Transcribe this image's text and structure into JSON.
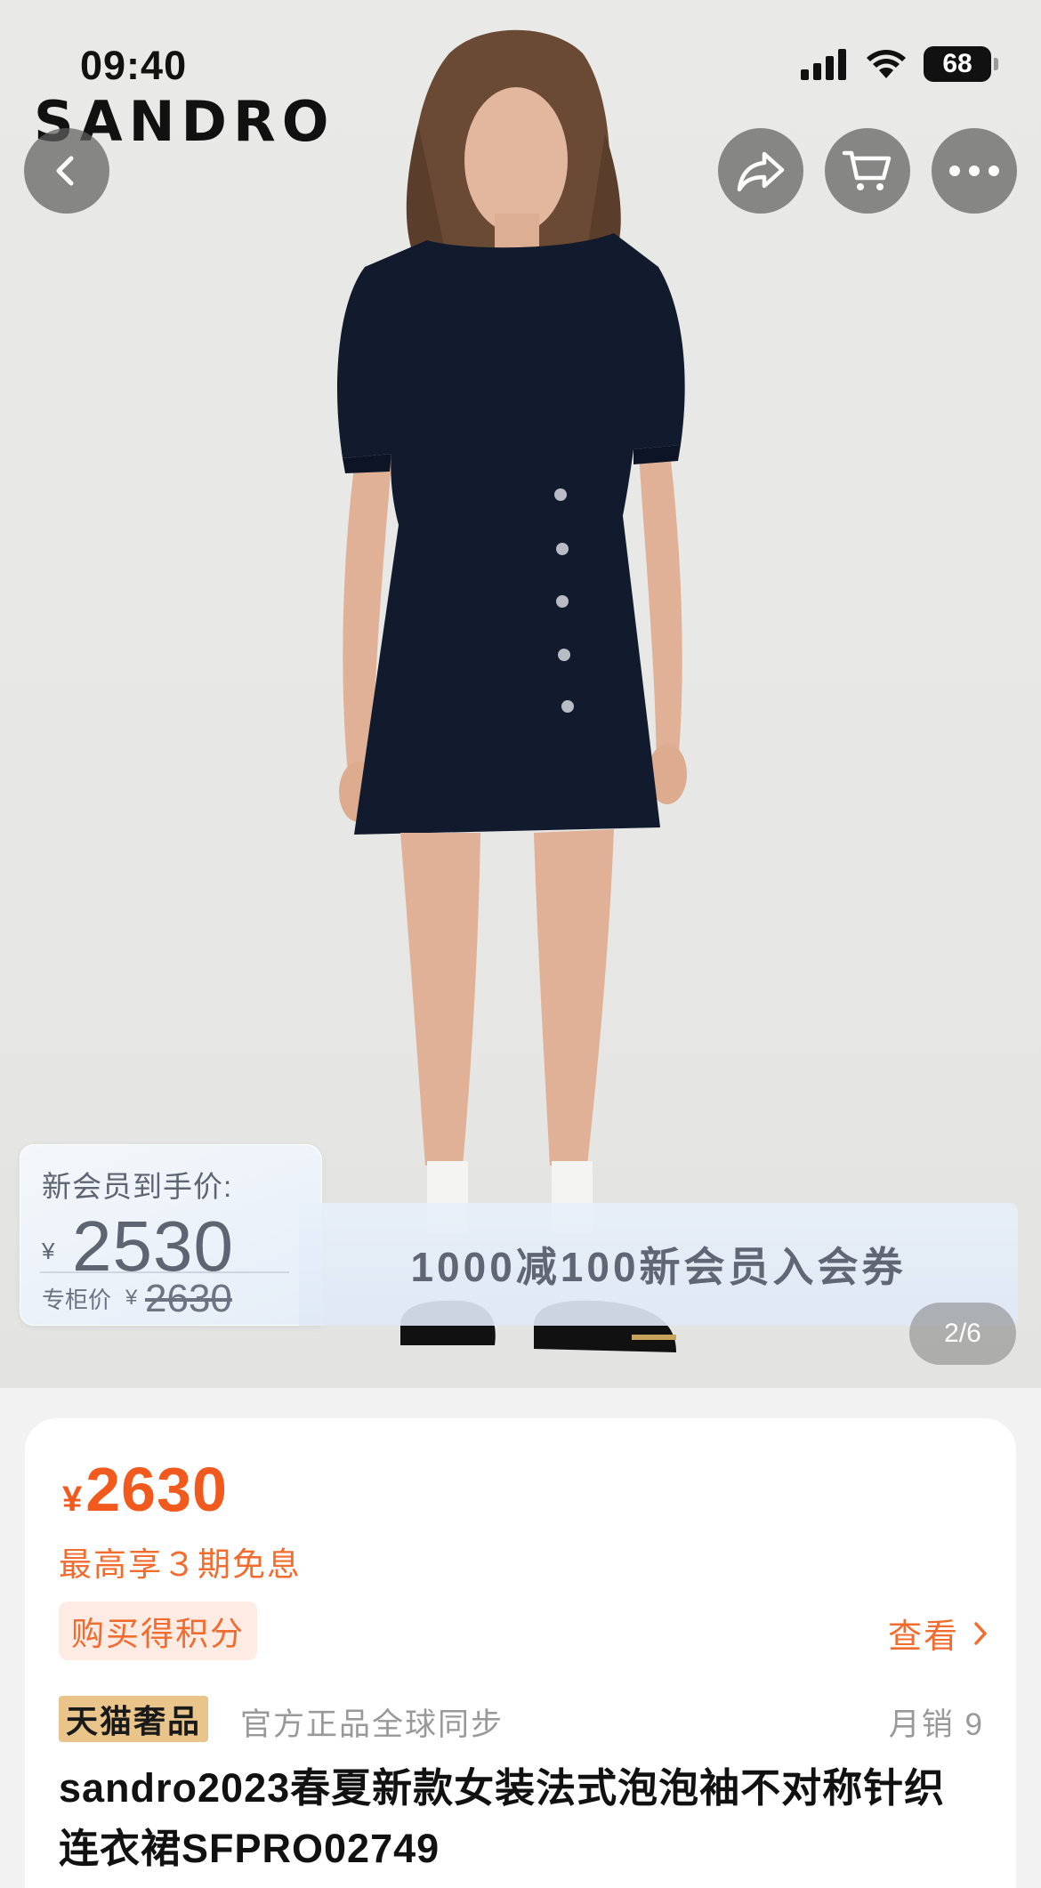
{
  "status_bar": {
    "time": "09:40",
    "battery": "68"
  },
  "brand": {
    "logo_text": "SANDRO"
  },
  "nav": {
    "back_icon": "chevron-left-icon",
    "share_icon": "share-arrow-icon",
    "cart_icon": "cart-icon",
    "more_icon": "more-dots-icon"
  },
  "promo": {
    "title": "新会员到手价:",
    "currency": "¥",
    "member_price": "2530",
    "original_label": "专柜价",
    "original_currency": "¥",
    "original_price": "2630",
    "banner_text": "1000减100新会员入会券"
  },
  "gallery": {
    "current": "2",
    "total": "6",
    "indicator": "2/6"
  },
  "product": {
    "currency": "¥",
    "price": "2630",
    "installment": "最高享３期免息",
    "points_label": "购买得积分",
    "view_label": "查看",
    "store_badge": "天猫奢品",
    "authentic_text": "官方正品全球同步",
    "monthly_sales": "月销 9",
    "title": "sandro2023春夏新款女装法式泡泡袖不对称针织连衣裙SFPRO02749"
  },
  "colors": {
    "accent": "#f2591d",
    "badge_gold": "#e9c48b",
    "points_bg": "#fdebe4"
  }
}
